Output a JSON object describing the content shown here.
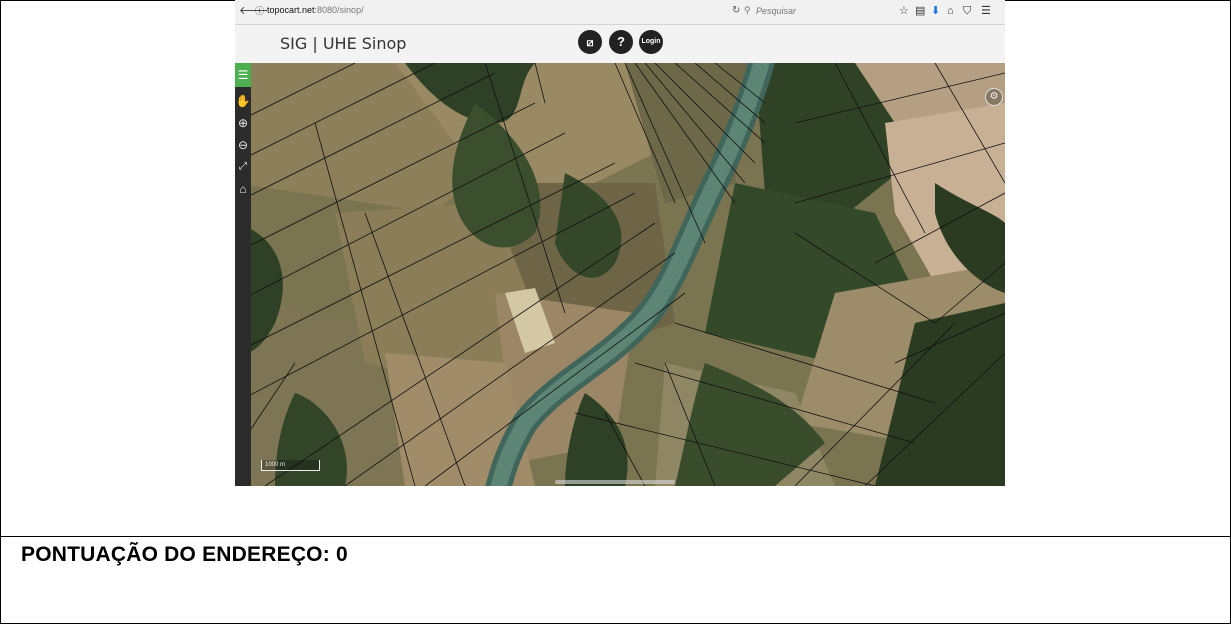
{
  "browser": {
    "url_host": "topocart.net",
    "url_rest": ":8080/sinop/",
    "search_placeholder": "Pesquisar"
  },
  "app": {
    "title": "SIG | UHE Sinop",
    "help_label": "?",
    "login_label": "Login"
  },
  "map": {
    "scale_label": "1000 m"
  },
  "caption": {
    "text": "PONTUAÇÃO DO ENDEREÇO: 0"
  },
  "icons": {
    "back": "back-arrow-icon",
    "info": "info-icon",
    "reload": "reload-icon",
    "search": "search-icon",
    "bookmark": "star-icon",
    "reading-list": "clipboard-icon",
    "download": "download-icon",
    "home": "home-icon",
    "pocket": "pocket-icon",
    "menu": "hamburger-menu-icon",
    "measure": "measure-icon",
    "help": "help-icon",
    "login": "login-icon",
    "side_menu": "hamburger-menu-icon",
    "pan": "hand-icon",
    "zoom_in": "zoom-in-icon",
    "zoom_out": "zoom-out-icon",
    "full_extent": "full-extent-icon",
    "home_view": "home-icon",
    "layers": "gear-icon"
  },
  "colors": {
    "menu_accent": "#4caf50",
    "toolbar_bg": "#2b2b2b",
    "header_btn": "#222222",
    "river": "#4f7a6a",
    "forest": "#2c3d22"
  }
}
